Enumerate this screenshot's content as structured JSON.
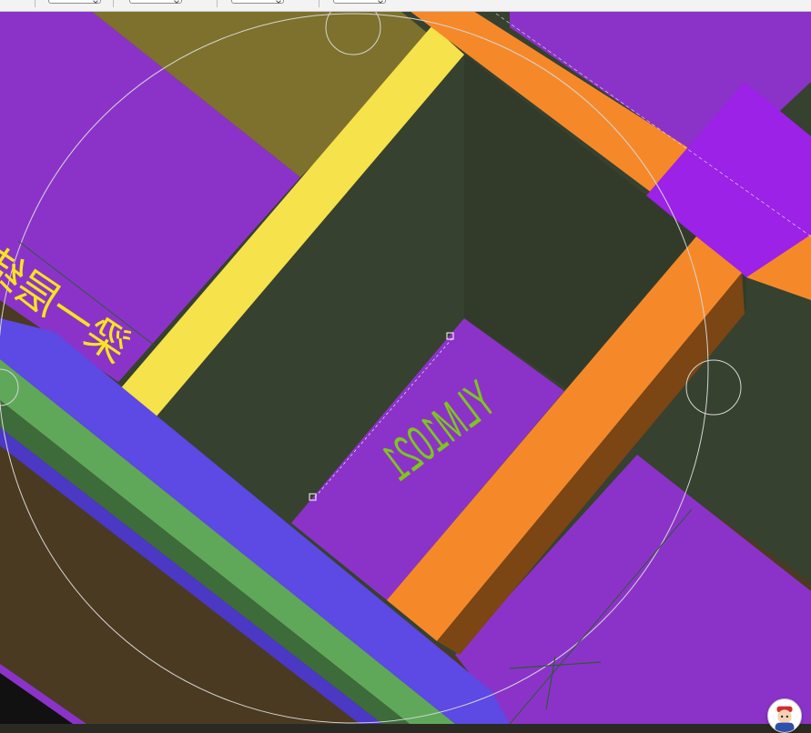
{
  "toolbar": {
    "boxes": [
      "",
      "",
      "",
      ""
    ]
  },
  "canvas": {
    "labels": {
      "opening": "YLM1021",
      "beam": "梁一层结构"
    }
  },
  "colors": {
    "purple_slab": "#8b33c9",
    "bright_purple": "#9b22e6",
    "olive_slab": "#7d712d",
    "yellow_beam": "#f6e24a",
    "dark_wall": "#37412f",
    "orange_beam": "#f5892a",
    "orange_beam_side": "#7c4514",
    "blue_beam": "#5d49e3",
    "green_strip": "#5fa85a",
    "label_green": "#7ec61c",
    "label_yellow": "#f7e51a",
    "guide_circle": "#d6d6d6"
  },
  "icons": {
    "assistant": "assistant-avatar-icon"
  }
}
